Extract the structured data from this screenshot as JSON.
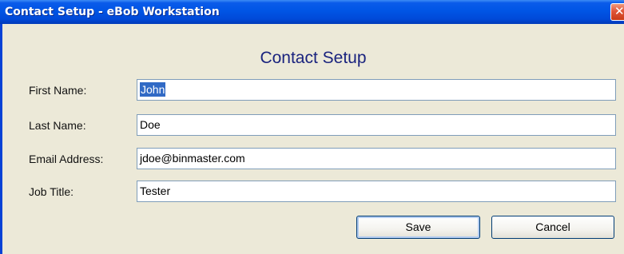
{
  "window": {
    "title": "Contact Setup - eBob Workstation",
    "close_glyph": "✕"
  },
  "dialog": {
    "heading": "Contact Setup"
  },
  "form": {
    "fields": [
      {
        "label": "First Name:",
        "value": "John",
        "selected": true
      },
      {
        "label": "Last Name:",
        "value": "Doe"
      },
      {
        "label": "Email Address:",
        "value": "jdoe@binmaster.com"
      },
      {
        "label": "Job Title:",
        "value": "Tester"
      }
    ]
  },
  "buttons": {
    "save_label": "Save",
    "cancel_label": "Cancel"
  },
  "colors": {
    "titlebar": "#0055e5",
    "window_body": "#ece9d8",
    "heading": "#1a237e",
    "selection": "#316ac5",
    "input_border": "#7f9db9"
  },
  "icons": {
    "close": "close-icon"
  }
}
